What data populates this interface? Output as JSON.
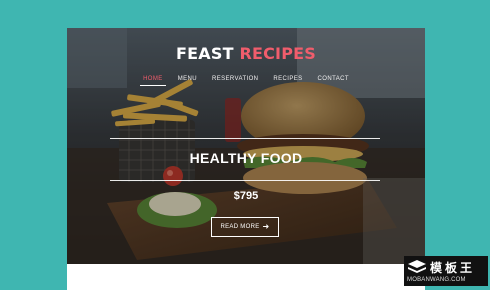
{
  "brand": {
    "part1": "FEAST",
    "part2": "RECIPES",
    "accent_color": "#f05d6c"
  },
  "nav": {
    "items": [
      {
        "label": "HOME",
        "active": true
      },
      {
        "label": "MENU",
        "active": false
      },
      {
        "label": "RESERVATION",
        "active": false
      },
      {
        "label": "RECIPES",
        "active": false
      },
      {
        "label": "CONTACT",
        "active": false
      }
    ]
  },
  "hero": {
    "headline": "HEALTHY FOOD",
    "price": "$795",
    "cta_label": "READ MORE",
    "cta_icon": "arrow-right-icon",
    "image": "burger-and-fries-photo"
  },
  "watermark": {
    "title": "模板王",
    "url": "MOBANWANG.COM"
  },
  "colors": {
    "page_background": "#3fb6b1",
    "overlay_text": "#ffffff"
  }
}
